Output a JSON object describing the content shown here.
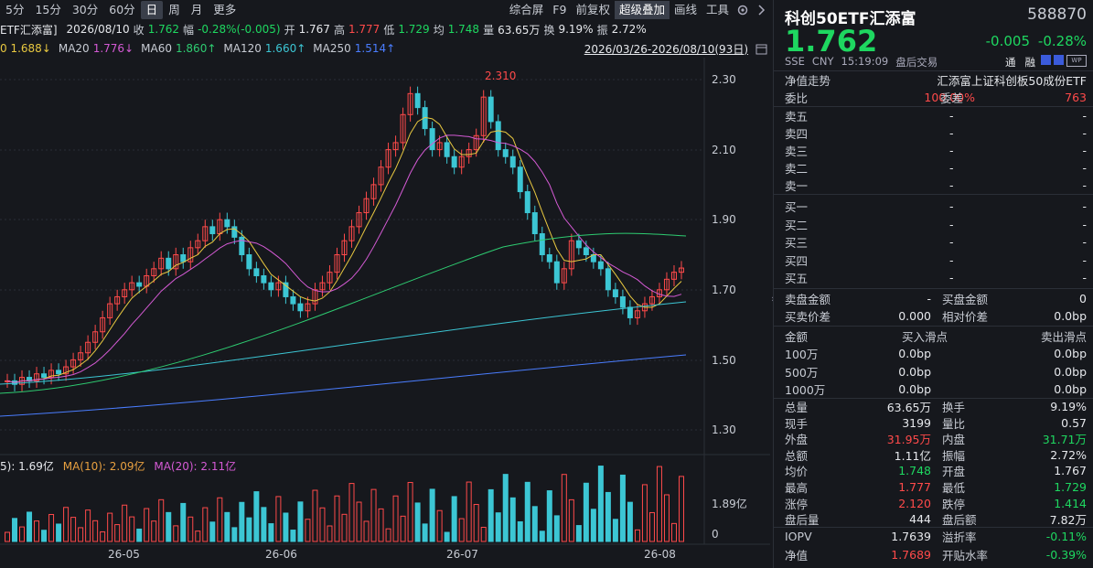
{
  "toolbar": {
    "periods": [
      "5分",
      "15分",
      "30分",
      "60分",
      "日",
      "周",
      "月",
      "更多"
    ],
    "active_period": "日",
    "tools": [
      "综合屏",
      "F9",
      "前复权",
      "超级叠加",
      "画线",
      "工具"
    ]
  },
  "info": {
    "name": "ETF汇添富]",
    "date": "2026/08/10",
    "close_label": "收",
    "close": "1.762",
    "amp_label": "幅",
    "amp": "-0.28%(-0.005)",
    "open_label": "开",
    "open": "1.767",
    "high_label": "高",
    "high": "1.777",
    "low_label": "低",
    "low": "1.729",
    "avg_label": "均",
    "avg": "1.748",
    "vol_label": "量",
    "vol": "63.65万",
    "turn_label": "换",
    "turn": "9.19%",
    "zhen_label": "振",
    "zhen": "2.72%"
  },
  "ma": {
    "ma10": "0 1.688↓",
    "ma20_label": "MA20",
    "ma20": "1.776↓",
    "ma60_label": "MA60",
    "ma60": "1.860↑",
    "ma120_label": "MA120",
    "ma120": "1.660↑",
    "ma250_label": "MA250",
    "ma250": "1.514↑",
    "range": "2026/03/26-2026/08/10(93日)"
  },
  "chart": {
    "y_ticks": [
      "2.30",
      "2.10",
      "1.90",
      "1.70",
      "1.50",
      "1.30"
    ],
    "max_label": "2.310",
    "x_ticks": [
      "26-05",
      "26-06",
      "26-07",
      "26-08"
    ]
  },
  "volume": {
    "legend_a": "5): 1.69亿",
    "legend_b": "MA(10): 2.09亿",
    "legend_c": "MA(20): 2.11亿",
    "y_ticks": [
      "1.89亿",
      "0"
    ]
  },
  "quote": {
    "title": "科创50ETF汇添富",
    "code": "588870",
    "price": "1.762",
    "change": "-0.005",
    "pct": "-0.28%",
    "exchange": "SSE",
    "currency": "CNY",
    "time": "15:19:09",
    "session": "盘后交易",
    "tong": "通",
    "rong": "融",
    "nav_trend": "净值走势",
    "index_name": "汇添富上证科创板50成份ETF",
    "weibi_label": "委比",
    "weibi": "100.00%",
    "weicha_label": "委差",
    "weicha": "763",
    "asks": [
      {
        "label": "卖五",
        "value": "-",
        "qty": "-"
      },
      {
        "label": "卖四",
        "value": "-",
        "qty": "-"
      },
      {
        "label": "卖三",
        "value": "-",
        "qty": "-"
      },
      {
        "label": "卖二",
        "value": "-",
        "qty": "-"
      },
      {
        "label": "卖一",
        "value": "-",
        "qty": "-"
      }
    ],
    "bids": [
      {
        "label": "买一",
        "value": "-",
        "qty": "-"
      },
      {
        "label": "买二",
        "value": "-",
        "qty": "-"
      },
      {
        "label": "买三",
        "value": "-",
        "qty": "-"
      },
      {
        "label": "买四",
        "value": "-",
        "qty": "-"
      },
      {
        "label": "买五",
        "value": "-",
        "qty": "-"
      }
    ],
    "sell_amt_label": "卖盘金额",
    "sell_amt": "-",
    "buy_amt_label": "买盘金额",
    "buy_amt": "0",
    "spread_label": "买卖价差",
    "spread": "0.000",
    "rel_spread_label": "相对价差",
    "rel_spread": "0.0bp",
    "slip_head": {
      "a": "金额",
      "b": "买入滑点",
      "c": "卖出滑点"
    },
    "slips": [
      {
        "amt": "100万",
        "buy": "0.0bp",
        "sell": "0.0bp"
      },
      {
        "amt": "500万",
        "buy": "0.0bp",
        "sell": "0.0bp"
      },
      {
        "amt": "1000万",
        "buy": "0.0bp",
        "sell": "0.0bp"
      }
    ],
    "stats": [
      {
        "l1": "总量",
        "v1": "63.65万",
        "c1": "white",
        "l2": "换手",
        "v2": "9.19%",
        "c2": "white"
      },
      {
        "l1": "现手",
        "v1": "3199",
        "c1": "white",
        "l2": "量比",
        "v2": "0.57",
        "c2": "white"
      },
      {
        "l1": "外盘",
        "v1": "31.95万",
        "c1": "red",
        "l2": "内盘",
        "v2": "31.71万",
        "c2": "green"
      },
      {
        "l1": "总额",
        "v1": "1.11亿",
        "c1": "white",
        "l2": "振幅",
        "v2": "2.72%",
        "c2": "white"
      },
      {
        "l1": "均价",
        "v1": "1.748",
        "c1": "green",
        "l2": "开盘",
        "v2": "1.767",
        "c2": "white"
      },
      {
        "l1": "最高",
        "v1": "1.777",
        "c1": "red",
        "l2": "最低",
        "v2": "1.729",
        "c2": "green"
      },
      {
        "l1": "涨停",
        "v1": "2.120",
        "c1": "red",
        "l2": "跌停",
        "v2": "1.414",
        "c2": "green"
      },
      {
        "l1": "盘后量",
        "v1": "444",
        "c1": "white",
        "l2": "盘后额",
        "v2": "7.82万",
        "c2": "white"
      }
    ],
    "iopv_label": "IOPV",
    "iopv": "1.7639",
    "premium_label": "溢折率",
    "premium": "-0.11%",
    "nav_label": "净值",
    "nav": "1.7689",
    "discount_label": "开贴水率",
    "discount": "-0.39%"
  }
}
